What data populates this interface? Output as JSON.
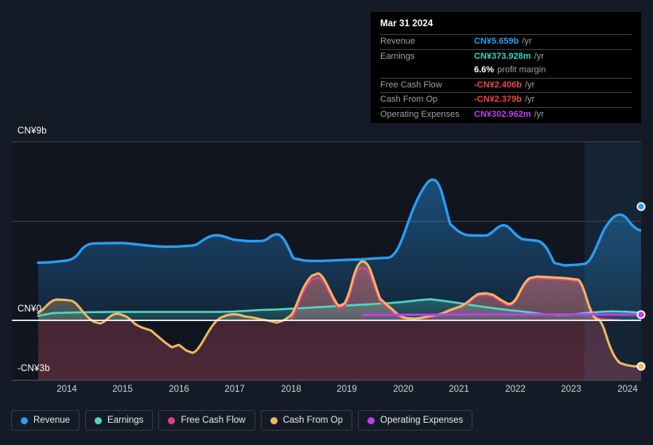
{
  "tooltip": {
    "date": "Mar 31 2024",
    "rows": [
      {
        "name": "Revenue",
        "value": "CN¥5.659b",
        "unit": "/yr",
        "color": "#2a9df4"
      },
      {
        "name": "Earnings",
        "value": "CN¥373.928m",
        "unit": "/yr",
        "color": "#35d6bd"
      },
      {
        "name": "Free Cash Flow",
        "value": "-CN¥2.406b",
        "unit": "/yr",
        "color": "#f04545"
      },
      {
        "name": "Cash From Op",
        "value": "-CN¥2.379b",
        "unit": "/yr",
        "color": "#f04545"
      },
      {
        "name": "Operating Expenses",
        "value": "CN¥302.962m",
        "unit": "/yr",
        "color": "#c03ef0"
      }
    ],
    "margin_value": "6.6%",
    "margin_label": "profit margin"
  },
  "legend": [
    {
      "label": "Revenue",
      "color": "#2a9df4",
      "icon": "revenue-dot"
    },
    {
      "label": "Earnings",
      "color": "#4fd8c3",
      "icon": "earnings-dot"
    },
    {
      "label": "Free Cash Flow",
      "color": "#e0407f",
      "icon": "free-cash-flow-dot"
    },
    {
      "label": "Cash From Op",
      "color": "#f0b860",
      "icon": "cash-from-op-dot"
    },
    {
      "label": "Operating Expenses",
      "color": "#c03ef0",
      "icon": "operating-expenses-dot"
    }
  ],
  "chart_data": {
    "type": "area",
    "title": "",
    "xlabel": "",
    "ylabel": "",
    "grid": true,
    "legend_position": "bottom",
    "ylim": [
      -3,
      9
    ],
    "xlim": [
      2013.5,
      2024.25
    ],
    "y_ticks": [
      {
        "value": 9,
        "label": "CN¥9b"
      },
      {
        "value": 0,
        "label": "CN¥0"
      },
      {
        "value": -3,
        "label": "-CN¥3b"
      }
    ],
    "gridlines": [
      9,
      6
    ],
    "zero_line": 0,
    "x_ticks": [
      {
        "value": 2014,
        "label": "2014"
      },
      {
        "value": 2015,
        "label": "2015"
      },
      {
        "value": 2016,
        "label": "2016"
      },
      {
        "value": 2017,
        "label": "2017"
      },
      {
        "value": 2018,
        "label": "2018"
      },
      {
        "value": 2019,
        "label": "2019"
      },
      {
        "value": 2020,
        "label": "2020"
      },
      {
        "value": 2021,
        "label": "2021"
      },
      {
        "value": 2022,
        "label": "2022"
      },
      {
        "value": 2023,
        "label": "2023"
      },
      {
        "value": 2024,
        "label": "2024"
      }
    ],
    "highlight_band": {
      "from": 2023.2,
      "to": 2024.25
    },
    "units": "CN¥ billions",
    "series": [
      {
        "name": "Revenue",
        "color": "#2a9df4",
        "x": [
          2013.5,
          2013.75,
          2014.0,
          2014.25,
          2014.5,
          2014.75,
          2015.0,
          2015.25,
          2015.5,
          2015.75,
          2016.0,
          2016.25,
          2016.5,
          2016.75,
          2017.0,
          2017.25,
          2017.5,
          2017.75,
          2018.0,
          2018.25,
          2018.5,
          2018.75,
          2019.0,
          2019.25,
          2019.5,
          2019.75,
          2020.0,
          2020.25,
          2020.5,
          2020.75,
          2021.0,
          2021.25,
          2021.5,
          2021.75,
          2022.0,
          2022.25,
          2022.5,
          2022.75,
          2023.0,
          2023.25,
          2023.5,
          2023.75,
          2024.0,
          2024.25
        ],
        "values": [
          2.1,
          2.12,
          2.35,
          2.78,
          2.82,
          2.8,
          2.76,
          2.7,
          2.72,
          2.74,
          2.74,
          2.88,
          3.04,
          2.96,
          2.92,
          3.0,
          3.06,
          2.5,
          2.42,
          2.4,
          2.38,
          2.42,
          2.52,
          2.56,
          2.46,
          2.42,
          2.6,
          3.4,
          4.8,
          5.3,
          6.95,
          5.9,
          5.5,
          5.46,
          5.75,
          5.6,
          5.4,
          5.3,
          2.6,
          3.0,
          3.46,
          5.2,
          5.9,
          5.659
        ]
      },
      {
        "name": "Earnings",
        "color": "#4fd8c3",
        "x": [
          2013.5,
          2014.0,
          2014.5,
          2015.0,
          2015.5,
          2016.0,
          2016.5,
          2017.0,
          2017.5,
          2018.0,
          2018.5,
          2019.0,
          2019.5,
          2020.0,
          2020.5,
          2021.0,
          2021.5,
          2022.0,
          2022.5,
          2023.0,
          2023.5,
          2024.0,
          2024.25
        ],
        "values": [
          0.22,
          0.36,
          0.4,
          0.42,
          0.42,
          0.42,
          0.42,
          0.42,
          0.42,
          0.44,
          0.48,
          0.52,
          0.56,
          0.62,
          0.7,
          0.58,
          0.5,
          0.4,
          0.26,
          0.3,
          0.4,
          0.42,
          0.374
        ]
      },
      {
        "name": "Free Cash Flow",
        "color": "#e0407f",
        "x": [
          2018.0,
          2018.25,
          2018.5,
          2018.75,
          2019.0,
          2019.25,
          2019.5,
          2019.75,
          2020.0,
          2020.5,
          2021.0,
          2021.5,
          2022.0,
          2022.25,
          2022.5,
          2022.75,
          2023.0,
          2023.25,
          2023.5,
          2023.75,
          2024.0,
          2024.25
        ],
        "values": [
          0.18,
          0.95,
          0.6,
          1.3,
          2.66,
          1.46,
          2.16,
          0.9,
          0.2,
          0.0,
          0.64,
          1.4,
          1.25,
          2.1,
          2.05,
          2.04,
          0.1,
          -0.06,
          -0.4,
          -1.8,
          -2.35,
          -2.406
        ]
      },
      {
        "name": "Cash From Op",
        "color": "#f0b860",
        "x": [
          2013.5,
          2013.75,
          2014.0,
          2014.25,
          2014.5,
          2014.75,
          2015.0,
          2015.25,
          2015.5,
          2015.75,
          2016.0,
          2016.25,
          2016.5,
          2016.75,
          2017.0,
          2017.25,
          2017.5,
          2017.75,
          2018.0,
          2018.25,
          2018.5,
          2018.75,
          2019.0,
          2019.25,
          2019.5,
          2019.75,
          2020.0,
          2020.25,
          2020.5,
          2020.75,
          2021.0,
          2021.25,
          2021.5,
          2021.75,
          2022.0,
          2022.25,
          2022.5,
          2022.75,
          2023.0,
          2023.25,
          2023.5,
          2023.75,
          2024.0,
          2024.25
        ],
        "values": [
          0.36,
          0.86,
          0.94,
          0.92,
          0.52,
          0.0,
          0.2,
          0.22,
          -0.2,
          -0.36,
          -1.1,
          -1.46,
          -1.24,
          -1.56,
          -0.5,
          0.26,
          0.5,
          0.3,
          0.22,
          1.0,
          0.66,
          1.36,
          2.72,
          1.52,
          2.22,
          0.96,
          0.24,
          0.05,
          0.1,
          0.7,
          0.76,
          1.5,
          1.34,
          0.7,
          2.2,
          2.14,
          2.12,
          2.1,
          0.2,
          0.0,
          -0.35,
          -1.75,
          -2.3,
          -2.379
        ]
      },
      {
        "name": "Operating Expenses",
        "color": "#c03ef0",
        "x": [
          2019.5,
          2020.0,
          2020.5,
          2021.0,
          2021.5,
          2022.0,
          2022.5,
          2023.0,
          2023.5,
          2024.0,
          2024.25
        ],
        "values": [
          0.28,
          0.29,
          0.29,
          0.3,
          0.3,
          0.3,
          0.3,
          0.3,
          0.3,
          0.3,
          0.303
        ]
      }
    ]
  }
}
